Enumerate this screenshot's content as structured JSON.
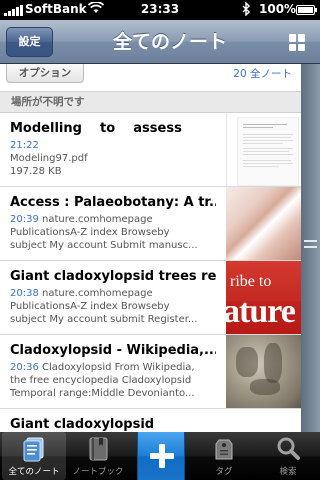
{
  "status_bar": {
    "carrier": "SoftBank",
    "time": "23:33",
    "battery": "100%"
  },
  "nav": {
    "settings_label": "設定",
    "title": "全てのノート"
  },
  "toolbar": {
    "options_label": "オプション",
    "note_count": "20 全ノート"
  },
  "section_header": "場所が不明です",
  "notes": [
    {
      "title": "Modelling    to    assess",
      "date": "21:22",
      "line1": "Modeling97.pdf",
      "line2": "197.28 KB"
    },
    {
      "title": "Access : Palaeobotany: A tr...",
      "date": "20:39",
      "line1_rest": "nature.comhomepage",
      "line1": "PublicationsA-Z index Browseby",
      "line2": "subject My account Submit manusc..."
    },
    {
      "title": "Giant cladoxylopsid trees re...",
      "date": "20:38",
      "line1_rest": "nature.comhomepage",
      "line1": "PublicationsA-Z index Browseby",
      "line2": "subject My account submit Register..."
    },
    {
      "title": "Cladoxylopsid - Wikipedia,...",
      "date": "20:36",
      "line1_rest": "Cladoxylopsid From Wikipedia,",
      "line1": "the free encyclopedia Cladoxylopsid",
      "line2": "Temporal range:Middle Devonianto..."
    },
    {
      "title": "Giant cladoxylopsid"
    }
  ],
  "thumb_text": {
    "nature_sub": "ribe to",
    "nature_logo": "ature"
  },
  "tabs": {
    "all_notes": "全てのノート",
    "notebooks": "ノートブック",
    "tags": "タグ",
    "search": "検索"
  },
  "colors": {
    "link_blue": "#3d72c4",
    "add_button": "#1b7dd4"
  }
}
